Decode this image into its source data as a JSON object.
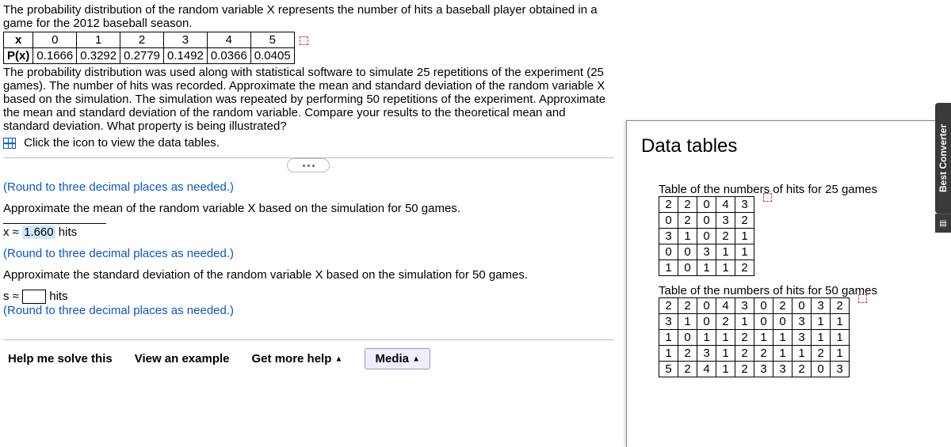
{
  "intro": "The probability distribution of the random variable X represents the number of hits a baseball player obtained in a game for the 2012 baseball season.",
  "prob_table": {
    "x_label": "x",
    "px_label": "P(x)",
    "x": [
      "0",
      "1",
      "2",
      "3",
      "4",
      "5"
    ],
    "px": [
      "0.1666",
      "0.3292",
      "0.2779",
      "0.1492",
      "0.0366",
      "0.0405"
    ]
  },
  "body1": "The probability distribution was used along with statistical software to simulate 25 repetitions of the experiment (25 games). The number of hits was recorded. Approximate the mean and standard deviation of the random variable X based on the simulation. The simulation was repeated by performing 50 repetitions of the experiment. Approximate the mean and standard deviation of the random variable. Compare your results to the theoretical mean and standard deviation. What property is being illustrated?",
  "click_icon": "Click the icon to view the data tables.",
  "round_note": "(Round to three decimal places as needed.)",
  "q_mean_50": "Approximate the mean of the random variable X based on the simulation for 50 games.",
  "x_approx_prefix": "x ≈",
  "x_approx_value": "1.660",
  "x_approx_suffix": "hits",
  "q_sd_50": "Approximate the standard deviation of the random variable X based on the simulation for 50 games.",
  "s_prefix": "s ≈",
  "s_suffix": "hits",
  "footer": {
    "help": "Help me solve this",
    "view": "View an example",
    "more": "Get more help",
    "media": "Media"
  },
  "popup": {
    "title": "Data tables",
    "label25": "Table of the numbers of hits for 25 games",
    "grid25": [
      [
        "2",
        "2",
        "0",
        "4",
        "3"
      ],
      [
        "0",
        "2",
        "0",
        "3",
        "2"
      ],
      [
        "3",
        "1",
        "0",
        "2",
        "1"
      ],
      [
        "0",
        "0",
        "3",
        "1",
        "1"
      ],
      [
        "1",
        "0",
        "1",
        "1",
        "2"
      ]
    ],
    "label50": "Table of the numbers of hits for 50 games",
    "grid50": [
      [
        "2",
        "2",
        "0",
        "4",
        "3",
        "0",
        "2",
        "0",
        "3",
        "2"
      ],
      [
        "3",
        "1",
        "0",
        "2",
        "1",
        "0",
        "0",
        "3",
        "1",
        "1"
      ],
      [
        "1",
        "0",
        "1",
        "1",
        "2",
        "1",
        "1",
        "3",
        "1",
        "1"
      ],
      [
        "1",
        "2",
        "3",
        "1",
        "2",
        "2",
        "1",
        "1",
        "2",
        "1"
      ],
      [
        "5",
        "2",
        "4",
        "1",
        "2",
        "3",
        "3",
        "2",
        "0",
        "3"
      ]
    ]
  },
  "side_tab": "Best Converter",
  "chart_data": {
    "type": "table",
    "title": "Probability distribution of number of hits",
    "categories": [
      0,
      1,
      2,
      3,
      4,
      5
    ],
    "values": [
      0.1666,
      0.3292,
      0.2779,
      0.1492,
      0.0366,
      0.0405
    ],
    "xlabel": "x",
    "ylabel": "P(x)"
  }
}
